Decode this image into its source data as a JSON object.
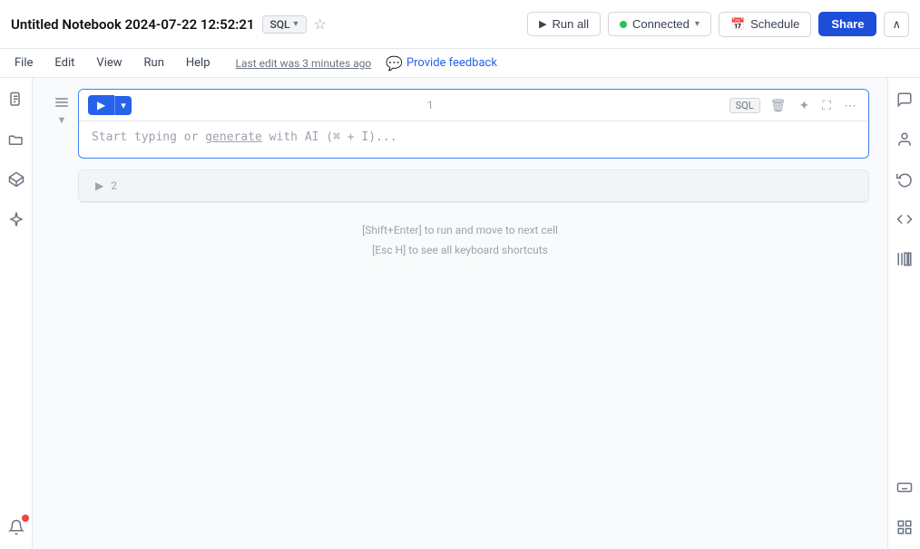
{
  "header": {
    "title": "Untitled Notebook 2024-07-22 12:52:21",
    "sql_label": "SQL",
    "sql_chevron": "▾",
    "star": "☆",
    "run_all": "Run all",
    "connected": "Connected",
    "schedule": "Schedule",
    "share": "Share",
    "collapse": "∧"
  },
  "menubar": {
    "file": "File",
    "edit": "Edit",
    "view": "View",
    "run": "Run",
    "help": "Help",
    "last_edit": "Last edit was 3 minutes ago",
    "provide_feedback": "Provide feedback"
  },
  "cells": [
    {
      "number": "1",
      "type": "SQL",
      "placeholder": "Start typing or generate with AI (⌘ + I)...",
      "generate_word": "generate",
      "active": true
    },
    {
      "number": "2",
      "active": false
    }
  ],
  "hints": {
    "line1": "[Shift+Enter] to run and move to next cell",
    "line2": "[Esc H] to see all keyboard shortcuts"
  },
  "sidebar_left": {
    "icons": [
      "document",
      "folder",
      "package",
      "sparkle"
    ]
  },
  "sidebar_right": {
    "icons": [
      "chat",
      "person",
      "history",
      "code",
      "library"
    ]
  }
}
